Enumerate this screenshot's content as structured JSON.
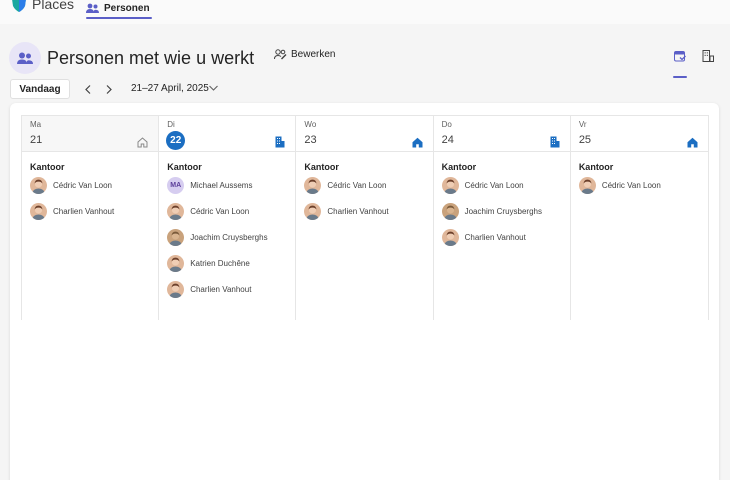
{
  "app": {
    "name": "Places",
    "active_tab": "Personen"
  },
  "header": {
    "title": "Personen met wie u werkt",
    "edit_label": "Bewerken"
  },
  "nav": {
    "today_label": "Vandaag",
    "date_range": "21–27 April, 2025"
  },
  "colors": {
    "accent": "#5b5fc7",
    "today": "#1b6ec2",
    "office_icon": "#1b6ec2"
  },
  "days": [
    {
      "weekday": "Ma",
      "day": "21",
      "is_today": false,
      "location_icon": "home-outline-icon",
      "location": "Kantoor",
      "people": [
        {
          "name": "Cédric Van Loon",
          "avatar": "photo"
        },
        {
          "name": "Charlien Vanhout",
          "avatar": "photo"
        }
      ]
    },
    {
      "weekday": "Di",
      "day": "22",
      "is_today": true,
      "location_icon": "office-building-icon",
      "location": "Kantoor",
      "people": [
        {
          "name": "Michael Aussems",
          "avatar": "initials",
          "initials": "MA"
        },
        {
          "name": "Cédric Van Loon",
          "avatar": "photo"
        },
        {
          "name": "Joachim Cruysberghs",
          "avatar": "photo"
        },
        {
          "name": "Katrien Duchêne",
          "avatar": "photo"
        },
        {
          "name": "Charlien Vanhout",
          "avatar": "photo"
        }
      ]
    },
    {
      "weekday": "Wo",
      "day": "23",
      "is_today": false,
      "location_icon": "home-filled-icon",
      "location": "Kantoor",
      "people": [
        {
          "name": "Cédric Van Loon",
          "avatar": "photo"
        },
        {
          "name": "Charlien Vanhout",
          "avatar": "photo"
        }
      ]
    },
    {
      "weekday": "Do",
      "day": "24",
      "is_today": false,
      "location_icon": "office-building-icon",
      "location": "Kantoor",
      "people": [
        {
          "name": "Cédric Van Loon",
          "avatar": "photo"
        },
        {
          "name": "Joachim Cruysberghs",
          "avatar": "photo"
        },
        {
          "name": "Charlien Vanhout",
          "avatar": "photo"
        }
      ]
    },
    {
      "weekday": "Vr",
      "day": "25",
      "is_today": false,
      "location_icon": "home-filled-icon",
      "location": "Kantoor",
      "people": [
        {
          "name": "Cédric Van Loon",
          "avatar": "photo"
        }
      ]
    }
  ]
}
